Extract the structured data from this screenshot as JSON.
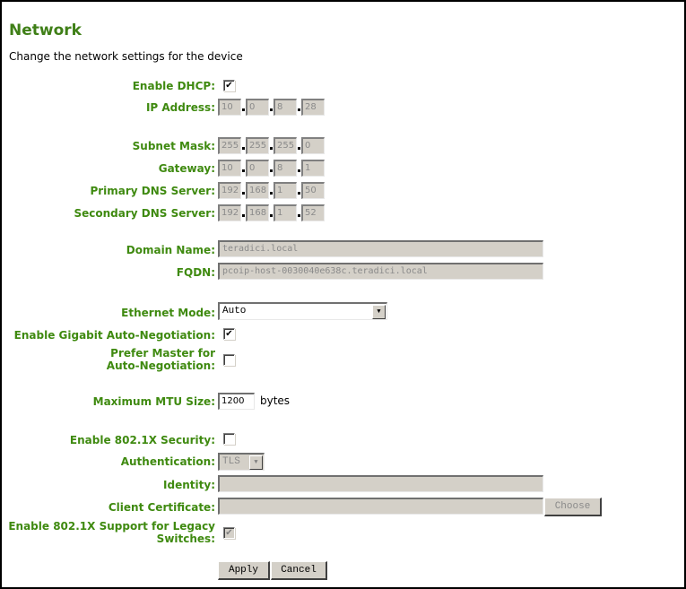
{
  "page": {
    "title": "Network",
    "subtitle": "Change the network settings for the device"
  },
  "form": {
    "dhcp": {
      "label": "Enable DHCP:",
      "checked": true,
      "mark": "✔"
    },
    "ip_address": {
      "label": "IP Address:",
      "octets": [
        "10",
        "0",
        "8",
        "28"
      ]
    },
    "subnet_mask": {
      "label": "Subnet Mask:",
      "octets": [
        "255",
        "255",
        "255",
        "0"
      ]
    },
    "gateway": {
      "label": "Gateway:",
      "octets": [
        "10",
        "0",
        "8",
        "1"
      ]
    },
    "primary_dns": {
      "label": "Primary DNS Server:",
      "octets": [
        "192",
        "168",
        "1",
        "50"
      ]
    },
    "secondary_dns": {
      "label": "Secondary DNS Server:",
      "octets": [
        "192",
        "168",
        "1",
        "52"
      ]
    },
    "domain_name": {
      "label": "Domain Name:",
      "value": "teradici.local"
    },
    "fqdn": {
      "label": "FQDN:",
      "value": "pcoip-host-0030040e638c.teradici.local"
    },
    "ethernet_mode": {
      "label": "Ethernet Mode:",
      "selected": "Auto",
      "arrow": "▼"
    },
    "gigabit_autoneg": {
      "label": "Enable Gigabit Auto-Negotiation:",
      "checked": true,
      "mark": "✔"
    },
    "prefer_master": {
      "label_line1": "Prefer Master for",
      "label_line2": "Auto-Negotiation:",
      "checked": false,
      "mark": ""
    },
    "mtu": {
      "label": "Maximum MTU Size:",
      "value": "1200",
      "unit": "bytes"
    },
    "security_8021x": {
      "label": "Enable 802.1X Security:",
      "checked": false,
      "mark": ""
    },
    "authentication": {
      "label": "Authentication:",
      "selected": "TLS",
      "arrow": "▼"
    },
    "identity": {
      "label": "Identity:",
      "value": ""
    },
    "client_certificate": {
      "label": "Client Certificate:",
      "value": "",
      "choose_label": "Choose"
    },
    "legacy_switches": {
      "label_line1": "Enable 802.1X Support for Legacy",
      "label_line2": "Switches:",
      "checked": true,
      "mark": "✔"
    }
  },
  "actions": {
    "apply_label": "Apply",
    "cancel_label": "Cancel"
  }
}
